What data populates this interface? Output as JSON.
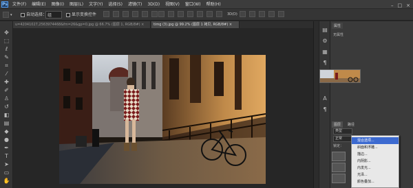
{
  "menubar": {
    "logo": "Ps",
    "items": [
      "文件(F)",
      "编辑(E)",
      "图像(I)",
      "图层(L)",
      "文字(Y)",
      "选择(S)",
      "滤镜(T)",
      "3D(D)",
      "视图(V)",
      "窗口(W)",
      "帮助(H)"
    ],
    "controls": [
      "–",
      "□",
      "×"
    ]
  },
  "options": {
    "auto_select_label": "自动选择：",
    "auto_select_value": "组",
    "show_transform_label": "显示变换控件"
  },
  "tabs": [
    {
      "label": "u=42041027,2563974468&fm=26&gp=0.jpg @ 66.7% (图层 1, RGB/8#) ×"
    },
    {
      "label": "timg (3).jpg @ 99.2% (图层 1 拷贝, RGB/8#) ×"
    }
  ],
  "panels": {
    "properties_title": "属性",
    "properties_empty": "无属性",
    "layers_tab": "图层",
    "paths_tab": "路径",
    "layer_kind": "类型",
    "blend_mode": "正常",
    "lock_label": "锁定："
  },
  "context_menu": {
    "items": [
      "混合选项...",
      "斜面和浮雕...",
      "描边...",
      "内阴影...",
      "内发光...",
      "光泽...",
      "颜色叠加...",
      "渐变叠加..."
    ]
  },
  "colors": {
    "accent": "#3c6ad0",
    "logo": "#4ea0ff"
  }
}
